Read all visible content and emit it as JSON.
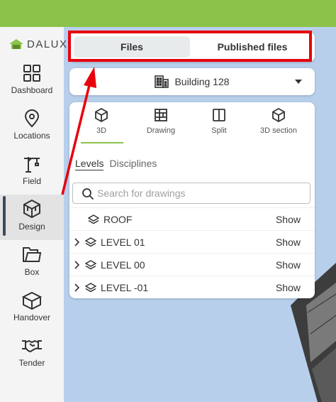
{
  "brand": {
    "logo_text": "DALUX",
    "accent": "#8bc34a",
    "annotation_color": "#e8000d"
  },
  "sidebar": {
    "items": [
      {
        "label": "Dashboard",
        "icon": "grid-icon",
        "active": false
      },
      {
        "label": "Locations",
        "icon": "location-pin-icon",
        "active": false
      },
      {
        "label": "Field",
        "icon": "crane-icon",
        "active": false
      },
      {
        "label": "Design",
        "icon": "cube-icon",
        "active": true
      },
      {
        "label": "Box",
        "icon": "folder-icon",
        "active": false
      },
      {
        "label": "Handover",
        "icon": "box-icon",
        "active": false
      },
      {
        "label": "Tender",
        "icon": "handshake-icon",
        "active": false
      }
    ]
  },
  "file_tabs": {
    "files": "Files",
    "published": "Published files",
    "selected": "Files"
  },
  "building": {
    "name": "Building 128",
    "icon": "building-icon"
  },
  "view_tabs": [
    {
      "label": "3D",
      "icon": "cube-icon",
      "selected": true
    },
    {
      "label": "Drawing",
      "icon": "drawing-icon",
      "selected": false
    },
    {
      "label": "Split",
      "icon": "split-icon",
      "selected": false
    },
    {
      "label": "3D section",
      "icon": "section-cube-icon",
      "selected": false
    }
  ],
  "subtabs": {
    "levels": "Levels",
    "disciplines": "Disciplines",
    "selected": "Levels"
  },
  "search": {
    "placeholder": "Search for drawings",
    "value": ""
  },
  "levels": [
    {
      "name": "ROOF",
      "action": "Show",
      "expandable": false
    },
    {
      "name": "LEVEL 01",
      "action": "Show",
      "expandable": true
    },
    {
      "name": "LEVEL 00",
      "action": "Show",
      "expandable": true
    },
    {
      "name": "LEVEL -01",
      "action": "Show",
      "expandable": true
    }
  ]
}
